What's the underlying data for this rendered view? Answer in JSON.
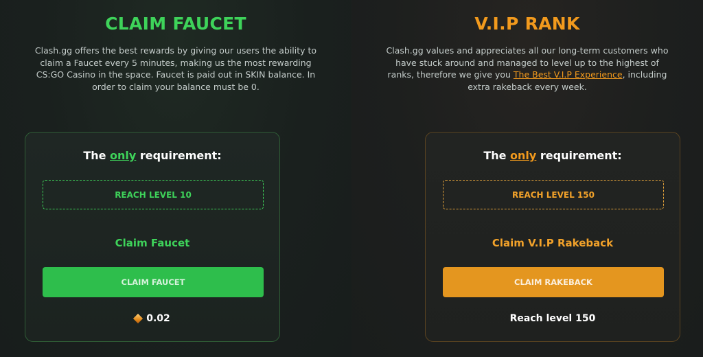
{
  "faucet": {
    "title": "CLAIM FAUCET",
    "description": "Clash.gg offers the best rewards by giving our users the ability to claim a Faucet every 5 minutes, making us the most rewarding CS:GO Casino in the space. Faucet is paid out in SKIN balance. In order to claim your balance must be 0.",
    "requirement_prefix": "The ",
    "requirement_only": "only",
    "requirement_suffix": " requirement:",
    "level_requirement": "REACH LEVEL 10",
    "claim_label": "Claim Faucet",
    "button_label": "CLAIM FAUCET",
    "amount": "0.02",
    "accent_color": "#3ed35a"
  },
  "vip": {
    "title": "V.I.P RANK",
    "description_before": "Clash.gg values and appreciates all our long-term customers who have stuck around and managed to level up to the highest of ranks, therefore we give you ",
    "description_link": "The Best V.I.P Experience",
    "description_after": ", including extra rakeback every week.",
    "requirement_prefix": "The ",
    "requirement_only": "only",
    "requirement_suffix": " requirement:",
    "level_requirement": "REACH LEVEL 150",
    "claim_label": "Claim V.I.P Rakeback",
    "button_label": "CLAIM RAKEBACK",
    "footer_text": "Reach level 150",
    "accent_color": "#f29a1d"
  },
  "icons": {
    "coin": "coin-icon"
  }
}
